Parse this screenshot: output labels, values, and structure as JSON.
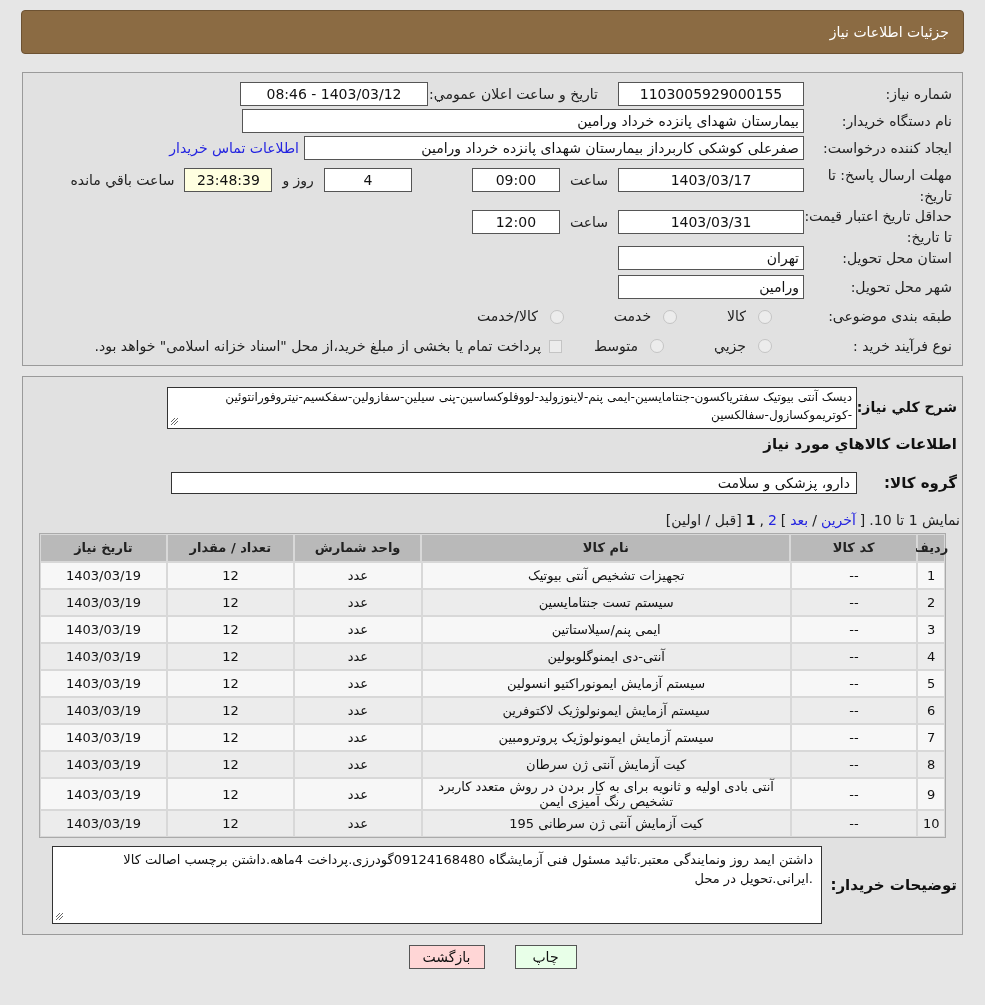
{
  "header": {
    "title": "جزئیات اطلاعات نیاز"
  },
  "need_number": {
    "label": "شماره نیاز:",
    "value": "1103005929000155"
  },
  "announce": {
    "label": "تاریخ و ساعت اعلان عمومي:",
    "value": "1403/03/12 - 08:46"
  },
  "buyer_org": {
    "label": "نام دستگاه خریدار:",
    "value": "بیمارستان شهدای پانزده خرداد ورامین"
  },
  "requester": {
    "label": "ایجاد کننده درخواست:",
    "value": "صفرعلی کوشکی کاربرداز بیمارستان شهدای پانزده خرداد ورامین",
    "link": "اطلاعات تماس خریدار"
  },
  "reply_deadline": {
    "label": "مهلت ارسال پاسخ: تا تاریخ:",
    "date": "1403/03/17",
    "time_label": "ساعت",
    "time": "09:00",
    "days": "4",
    "days_label": "روز و",
    "remaining": "23:48:39",
    "remaining_label": "ساعت باقي مانده"
  },
  "validity": {
    "label": "حداقل تاریخ اعتبار قیمت: تا تاریخ:",
    "date": "1403/03/31",
    "time_label": "ساعت",
    "time": "12:00"
  },
  "province": {
    "label": "استان محل تحویل:",
    "value": "تهران"
  },
  "city": {
    "label": "شهر محل تحویل:",
    "value": "ورامین"
  },
  "category": {
    "label": "طبقه بندی موضوعی:",
    "options": [
      {
        "label": "کالا",
        "selected": false
      },
      {
        "label": "خدمت",
        "selected": false
      },
      {
        "label": "کالا/خدمت",
        "selected": false
      }
    ]
  },
  "purchase_type": {
    "label": "نوع فرآیند خرید :",
    "options": [
      {
        "label": "جزيي",
        "selected": false
      },
      {
        "label": "متوسط",
        "selected": false
      }
    ],
    "note": {
      "text": "پرداخت تمام یا بخشی از مبلغ خرید،از محل \"اسناد خزانه اسلامی\" خواهد بود.",
      "checked": false
    }
  },
  "description": {
    "label": "شرح كلي نياز:",
    "value": "دیسک آنتی بیوتیک سفتریاکسون-جنتامایسین-ایمی پنم-لاینوزولید-لووفلوکساسین-پنی سیلین-سفازولین-سفکسیم-نیتروفورانتوئین -کوتریموکسازول-سفالکسین"
  },
  "goods_title": "اطلاعات كالاهاي مورد نياز",
  "goods_group": {
    "label": "گروه کالا:",
    "value": "دارو، پزشکی و سلامت"
  },
  "pagination": {
    "showing": "نمایش 1 تا 10.",
    "open": "[",
    "last": "آخرین",
    "sep": "/",
    "next": "بعد",
    "close": "]",
    "page_2": "2",
    "comma": ",",
    "current": "1",
    "prev_first": "[قبل / اولین]"
  },
  "table": {
    "columns": [
      "ردیف",
      "کد کالا",
      "نام کالا",
      "واحد شمارش",
      "تعداد / مقدار",
      "تاریخ نیاز"
    ],
    "rows": [
      [
        "1",
        "--",
        "تجهیزات تشخیص آنتی بیوتیک",
        "عدد",
        "12",
        "1403/03/19"
      ],
      [
        "2",
        "--",
        "سیستم تست جنتامایسین",
        "عدد",
        "12",
        "1403/03/19"
      ],
      [
        "3",
        "--",
        "ایمی پنم/سیلاستاتین",
        "عدد",
        "12",
        "1403/03/19"
      ],
      [
        "4",
        "--",
        "آنتی-دی ایمنوگلوبولین",
        "عدد",
        "12",
        "1403/03/19"
      ],
      [
        "5",
        "--",
        "سیستم آزمایش ایمونوراکتیو انسولین",
        "عدد",
        "12",
        "1403/03/19"
      ],
      [
        "6",
        "--",
        "سیستم آزمایش ایمونولوژیک لاکتوفرین",
        "عدد",
        "12",
        "1403/03/19"
      ],
      [
        "7",
        "--",
        "سیستم آزمایش ایمونولوژیک پروترومبین",
        "عدد",
        "12",
        "1403/03/19"
      ],
      [
        "8",
        "--",
        "کیت آزمایش آنتی ژن سرطان",
        "عدد",
        "12",
        "1403/03/19"
      ],
      [
        "9",
        "--",
        "آنتی بادی اولیه و ثانویه برای به کار بردن در روش متعدد کاربرد تشخیص رنگ آمیزی ایمن",
        "عدد",
        "12",
        "1403/03/19"
      ],
      [
        "10",
        "--",
        "کیت آزمایش آنتی ژن سرطانی 195",
        "عدد",
        "12",
        "1403/03/19"
      ]
    ]
  },
  "buyer_notes": {
    "label": "توضیحات خریدار:",
    "value": "داشتن ایمد روز ونمایندگی معتبر.تائید مسئول فنی آزمایشگاه 09124168480گودرزی.پرداخت 4ماهه.داشتن برچسب اصالت کالا .ایرانی.تحویل در محل"
  },
  "buttons": {
    "print": "چاپ",
    "back": "بازگشت"
  }
}
